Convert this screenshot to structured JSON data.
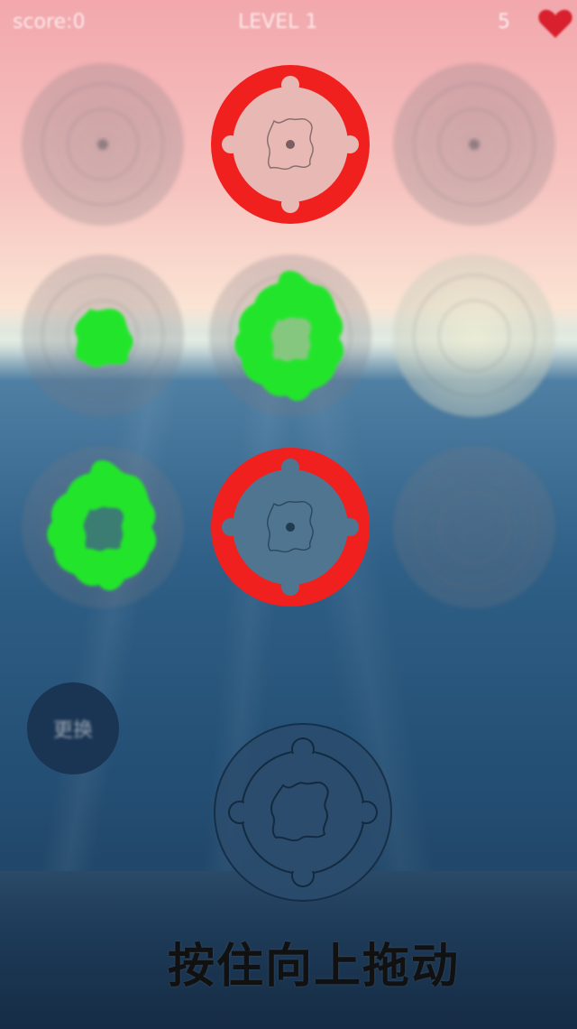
{
  "topbar": {
    "score_text": "score:0",
    "level_text": "LEVEL 1",
    "lives_count": "5",
    "heart_icon": "heart-icon"
  },
  "board": {
    "rows": 3,
    "cols": 3,
    "cells": [
      {
        "row": 0,
        "col": 0,
        "state": "empty"
      },
      {
        "row": 0,
        "col": 1,
        "state": "red-ring-target"
      },
      {
        "row": 0,
        "col": 2,
        "state": "empty"
      },
      {
        "row": 1,
        "col": 0,
        "state": "green-small"
      },
      {
        "row": 1,
        "col": 1,
        "state": "green-large"
      },
      {
        "row": 1,
        "col": 2,
        "state": "empty"
      },
      {
        "row": 2,
        "col": 0,
        "state": "green-large"
      },
      {
        "row": 2,
        "col": 1,
        "state": "red-ring-target"
      },
      {
        "row": 2,
        "col": 2,
        "state": "empty"
      }
    ]
  },
  "colors": {
    "red_ring": "#f0201f",
    "green_piece": "#22e52b",
    "swap_button": "#1a3553",
    "hint_text": "#111111"
  },
  "swap_button": {
    "label": "更换"
  },
  "drag_piece": {
    "icon": "gear-disc-icon"
  },
  "hint": {
    "text": "按住向上拖动"
  }
}
